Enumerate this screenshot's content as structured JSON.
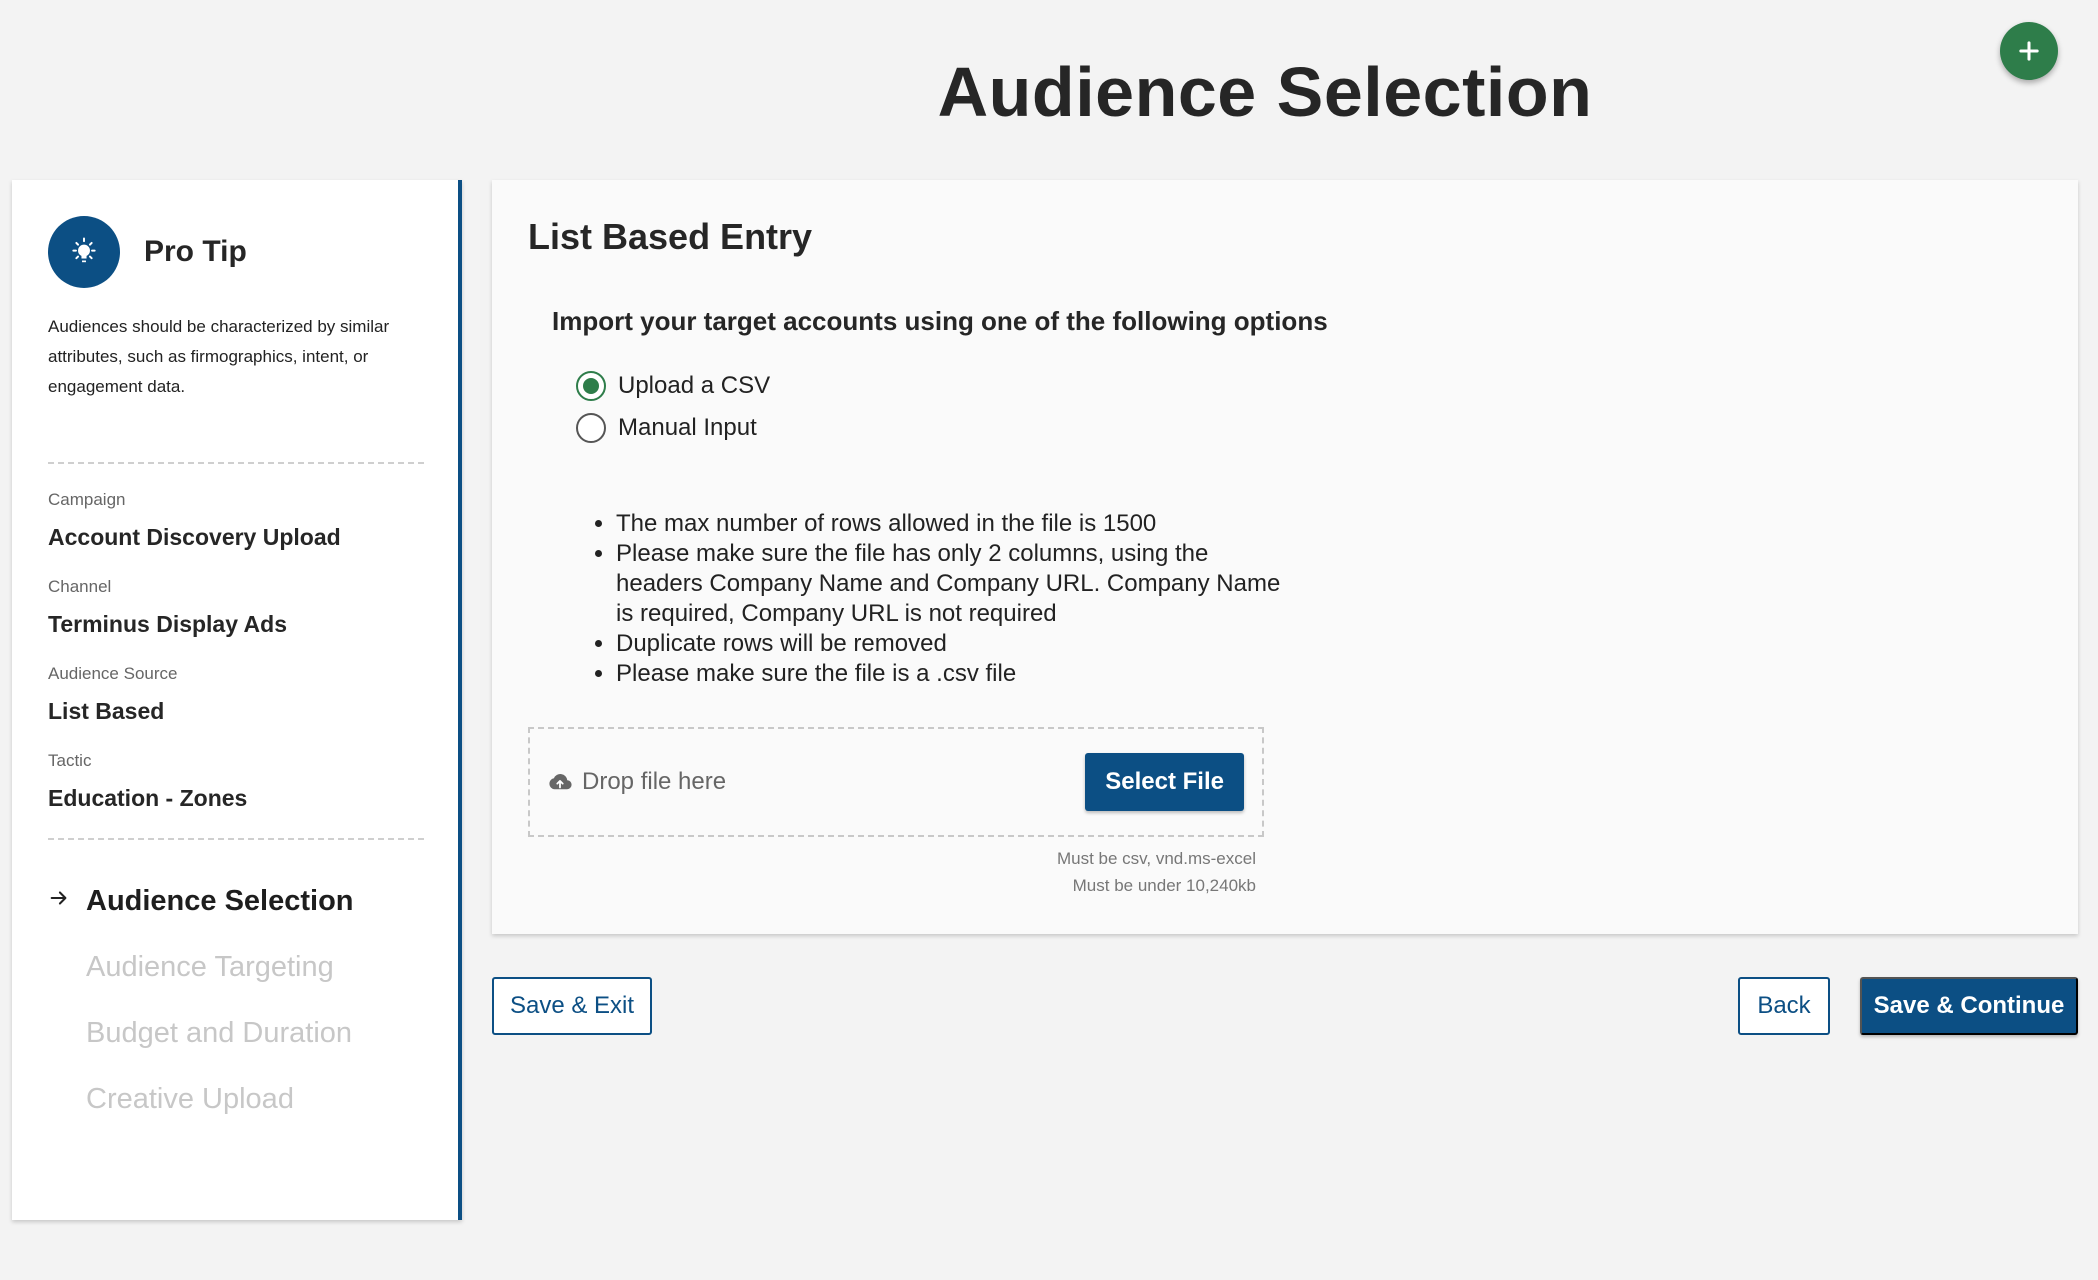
{
  "header": {
    "title": "Audience Selection"
  },
  "colors": {
    "primary": "#0c4f84",
    "success": "#2e7d4a",
    "disabled_text": "#c7c7c7"
  },
  "fab": {
    "icon": "plus-icon"
  },
  "sidebar": {
    "tip": {
      "icon": "lightbulb-icon",
      "title": "Pro Tip",
      "body": "Audiences should be characterized by similar attributes, such as firmographics, intent, or engagement data."
    },
    "meta": [
      {
        "label": "Campaign",
        "value": "Account Discovery Upload"
      },
      {
        "label": "Channel",
        "value": "Terminus Display Ads"
      },
      {
        "label": "Audience Source",
        "value": "List Based"
      },
      {
        "label": "Tactic",
        "value": "Education - Zones"
      }
    ],
    "steps": [
      {
        "label": "Audience Selection",
        "active": true
      },
      {
        "label": "Audience Targeting",
        "active": false
      },
      {
        "label": "Budget and Duration",
        "active": false
      },
      {
        "label": "Creative Upload",
        "active": false
      }
    ]
  },
  "main": {
    "card_title": "List Based Entry",
    "import_title": "Import your target accounts using one of the following options",
    "options": [
      {
        "label": "Upload a CSV",
        "checked": true
      },
      {
        "label": "Manual Input",
        "checked": false
      }
    ],
    "rules": [
      "The max number of rows allowed in the file is 1500",
      "Please make sure the file has only 2 columns, using the headers Company Name and Company URL. Company Name is required, Company URL is not required",
      "Duplicate rows will be removed",
      "Please make sure the file is a .csv file"
    ],
    "dropzone": {
      "icon": "cloud-upload-icon",
      "text": "Drop file here",
      "button": "Select File",
      "hints": [
        "Must be csv, vnd.ms-excel",
        "Must be under 10,240kb"
      ]
    }
  },
  "footer": {
    "save_exit": "Save & Exit",
    "back": "Back",
    "continue": "Save & Continue"
  }
}
